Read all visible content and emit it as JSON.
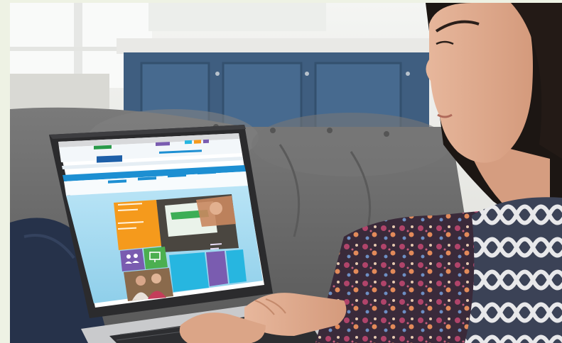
{
  "scene": {
    "colors": {
      "page_background": "#eef2e4",
      "cabinet_blue": "#3f5e80",
      "sofa_gray": "#6c6c6c",
      "laptop_frame": "#2b2b2d",
      "site_blue": "#1d8fd2",
      "site_orange": "#f59a1c",
      "site_purple": "#7a5cb0",
      "site_green": "#4caf50",
      "site_cyan": "#27b6e0",
      "site_sky": "#9fd6ee"
    },
    "icons": [
      "monitor-icon",
      "people-icon"
    ]
  }
}
